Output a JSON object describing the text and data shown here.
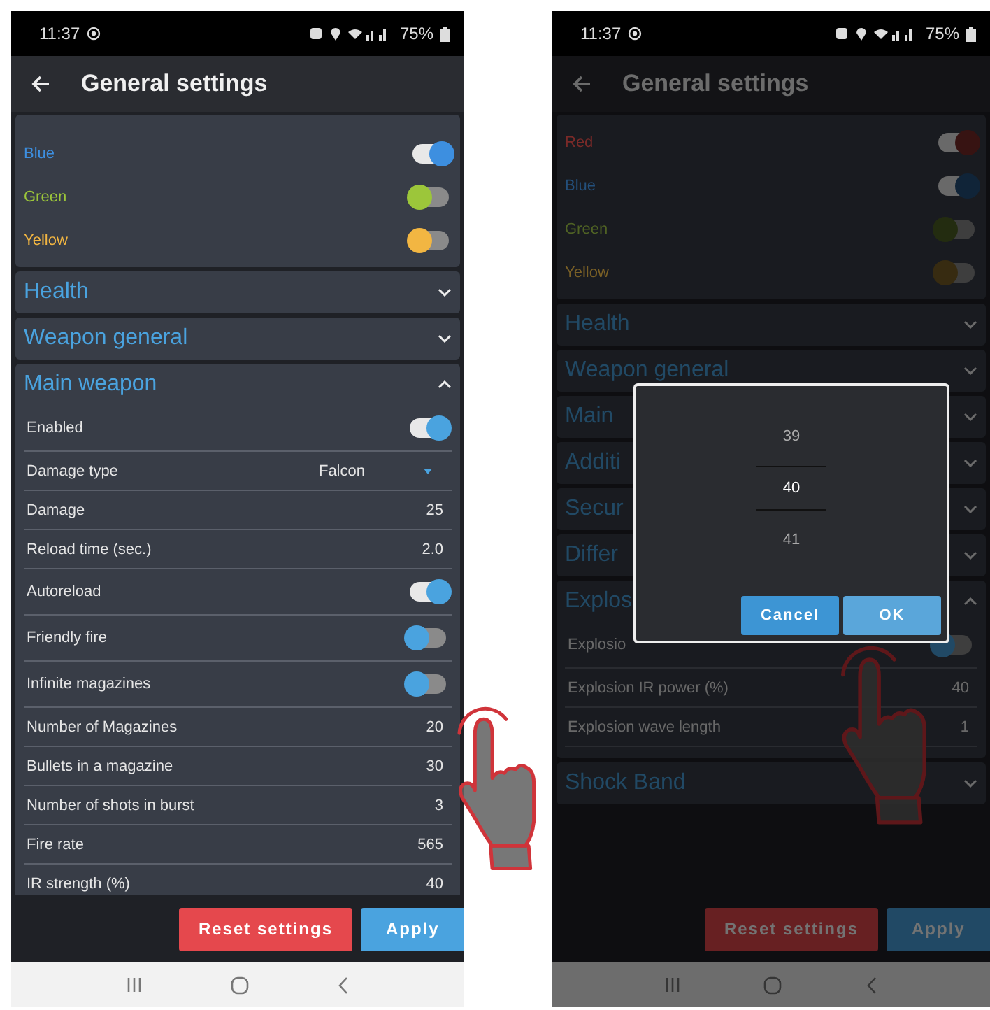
{
  "screens": [
    {
      "status_bar": {
        "time": "11:37",
        "battery": "75%"
      },
      "app_bar": {
        "title": "General settings"
      },
      "color_toggles": [
        {
          "label": "Blue",
          "color": "#3d8fe0",
          "on": true
        },
        {
          "label": "Green",
          "color": "#9cc63a",
          "on": false
        },
        {
          "label": "Yellow",
          "color": "#f2b642",
          "on": false
        }
      ],
      "sections": [
        {
          "title": "Health",
          "expanded": false
        },
        {
          "title": "Weapon general",
          "expanded": false
        },
        {
          "title": "Main weapon",
          "expanded": true,
          "rows": [
            {
              "kind": "toggle",
              "label": "Enabled",
              "on": true
            },
            {
              "kind": "dropdown",
              "label": "Damage type",
              "value": "Falcon"
            },
            {
              "kind": "value",
              "label": "Damage",
              "value": "25"
            },
            {
              "kind": "value",
              "label": "Reload time (sec.)",
              "value": "2.0"
            },
            {
              "kind": "toggle",
              "label": "Autoreload",
              "on": true
            },
            {
              "kind": "toggle",
              "label": "Friendly fire",
              "on": false
            },
            {
              "kind": "toggle",
              "label": "Infinite magazines",
              "on": false
            },
            {
              "kind": "value",
              "label": "Number of Magazines",
              "value": "20"
            },
            {
              "kind": "value",
              "label": "Bullets in a magazine",
              "value": "30"
            },
            {
              "kind": "value",
              "label": "Number of shots in burst",
              "value": "3"
            },
            {
              "kind": "value",
              "label": "Fire rate",
              "value": "565"
            },
            {
              "kind": "value",
              "label": "IR strength (%)",
              "value": "40"
            }
          ]
        }
      ],
      "buttons": [
        {
          "kind": "reset",
          "label": "Reset settings"
        },
        {
          "kind": "apply",
          "label": "Apply"
        }
      ]
    },
    {
      "status_bar": {
        "time": "11:37",
        "battery": "75%"
      },
      "app_bar": {
        "title": "General settings"
      },
      "color_toggles": [
        {
          "label": "Red",
          "color": "#7a2a28",
          "on": true
        },
        {
          "label": "Blue",
          "color": "#24507c",
          "on": true
        },
        {
          "label": "Green",
          "color": "#4f6224",
          "on": false
        },
        {
          "label": "Yellow",
          "color": "#7a6026",
          "on": false
        }
      ],
      "sections": [
        {
          "title": "Health",
          "expanded": false
        },
        {
          "title": "Weapon general",
          "expanded": false
        },
        {
          "title": "Main",
          "expanded": false
        },
        {
          "title": "Additi",
          "expanded": false
        },
        {
          "title": "Secur",
          "expanded": false
        },
        {
          "title": "Differ",
          "expanded": false
        },
        {
          "title": "Explos",
          "expanded": true,
          "rows": [
            {
              "kind": "toggle",
              "label": "Explosio",
              "on": false
            },
            {
              "kind": "value",
              "label": "Explosion IR power (%)",
              "value": "40"
            },
            {
              "kind": "value",
              "label": "Explosion wave length",
              "value": "1"
            }
          ]
        },
        {
          "title": "Shock Band",
          "expanded": false
        }
      ],
      "buttons": [
        {
          "kind": "reset",
          "label": "Reset settings"
        },
        {
          "kind": "apply",
          "label": "Apply"
        }
      ],
      "dialog": {
        "picker": [
          {
            "value": "39",
            "selected": false
          },
          {
            "value": "40",
            "selected": true
          },
          {
            "value": "41",
            "selected": false
          }
        ],
        "buttons": [
          {
            "kind": "cancel",
            "label": "Cancel"
          },
          {
            "kind": "ok",
            "label": "OK"
          }
        ]
      }
    }
  ]
}
